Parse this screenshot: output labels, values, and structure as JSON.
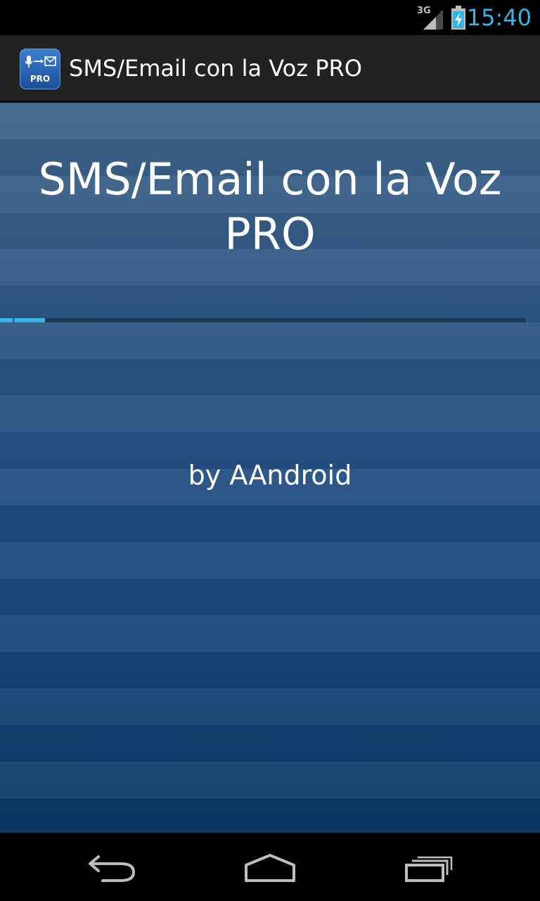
{
  "status_bar": {
    "network_type": "3G",
    "time": "15:40",
    "icons": [
      "signal-icon",
      "battery-charging-icon"
    ]
  },
  "action_bar": {
    "app_icon": "app-icon",
    "app_icon_label": "PRO",
    "title": "SMS/Email con la Voz PRO"
  },
  "splash": {
    "title": "SMS/Email con la Voz PRO",
    "progress": 0.085,
    "credit": "by AAndroid"
  },
  "nav_bar": {
    "icons": [
      "back-icon",
      "home-icon",
      "recents-icon"
    ]
  },
  "colors": {
    "accent": "#33b5e5",
    "action_bar": "#222222",
    "content_top": "#3e6488",
    "content_bottom": "#0b3766"
  }
}
